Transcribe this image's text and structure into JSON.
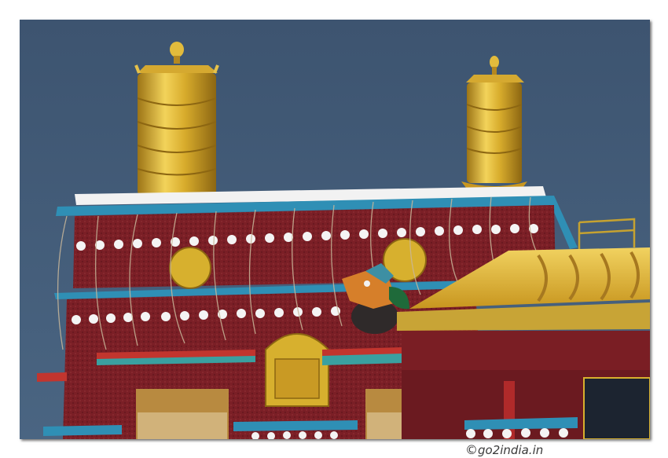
{
  "photo": {
    "subject": "",
    "colors": {
      "sky": "#3e5673",
      "wall": "#7a1e24",
      "gold": "#d7b02e",
      "trim_blue": "#2f8fb5",
      "white_trim": "#f2f2f2"
    }
  },
  "watermark": {
    "symbol": "©",
    "text": "go2india.in"
  }
}
